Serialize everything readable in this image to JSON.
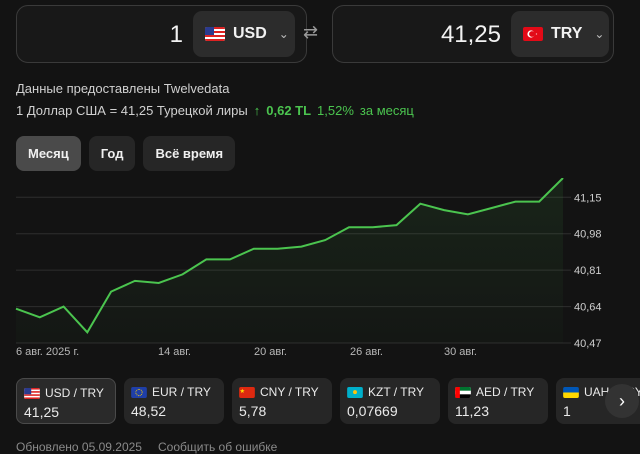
{
  "converter": {
    "from": {
      "amount": "1",
      "currency": "USD"
    },
    "to": {
      "amount": "41,25",
      "currency": "TRY"
    }
  },
  "source_text": "Данные предоставлены Twelvedata",
  "rate": {
    "text": "1 Доллар США = 41,25 Турецкой лиры",
    "change_abs": "0,62 TL",
    "change_pct": "1,52%",
    "period_text": "за месяц"
  },
  "tabs": [
    "Месяц",
    "Год",
    "Всё время"
  ],
  "chart_data": {
    "type": "line",
    "x_labels": [
      "6 авг. 2025 г.",
      "14 авг.",
      "20 авг.",
      "26 авг.",
      "30 авг."
    ],
    "y_ticks": [
      "41,15",
      "40,98",
      "40,81",
      "40,64",
      "40,47"
    ],
    "ylim": [
      40.47,
      41.24
    ],
    "values": [
      40.63,
      40.59,
      40.64,
      40.52,
      40.71,
      40.76,
      40.75,
      40.79,
      40.86,
      40.86,
      40.91,
      40.91,
      40.92,
      40.95,
      41.01,
      41.01,
      41.02,
      41.12,
      41.09,
      41.07,
      41.1,
      41.13,
      41.13,
      41.24
    ],
    "line_color": "#4bc44f",
    "grid": true
  },
  "pairs": [
    {
      "label": "USD / TRY",
      "value": "41,25",
      "flag": "us"
    },
    {
      "label": "EUR / TRY",
      "value": "48,52",
      "flag": "eu"
    },
    {
      "label": "CNY / TRY",
      "value": "5,78",
      "flag": "cn"
    },
    {
      "label": "KZT / TRY",
      "value": "0,07669",
      "flag": "kz"
    },
    {
      "label": "AED / TRY",
      "value": "11,23",
      "flag": "ae"
    },
    {
      "label": "UAH / TRY",
      "value": "1",
      "flag": "ua"
    }
  ],
  "footer": {
    "updated": "Обновлено 05.09.2025",
    "report": "Сообщить об ошибке"
  }
}
